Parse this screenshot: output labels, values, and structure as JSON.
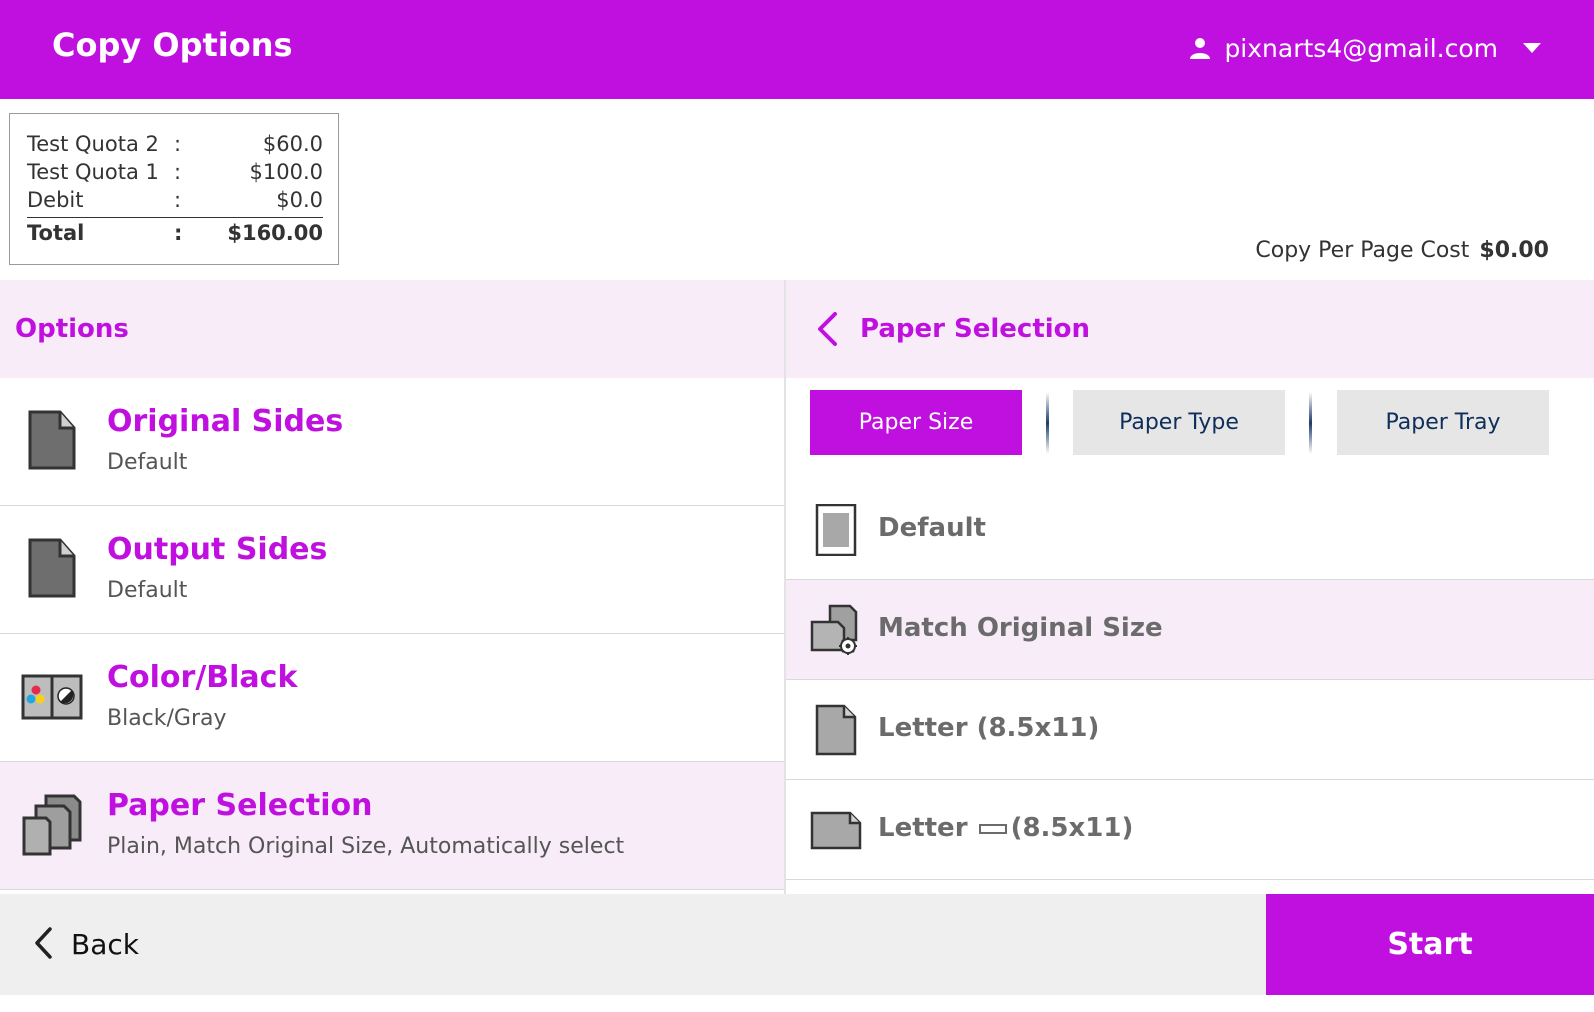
{
  "header": {
    "title": "Copy Options",
    "user_email": "pixnarts4@gmail.com"
  },
  "quota": {
    "rows": [
      {
        "label": "Test Quota 2",
        "sep": ":",
        "value": "$60.0"
      },
      {
        "label": "Test Quota 1",
        "sep": ":",
        "value": "$100.0"
      },
      {
        "label": "Debit",
        "sep": ":",
        "value": "$0.0"
      }
    ],
    "total": {
      "label": "Total",
      "sep": ":",
      "value": "$160.00"
    }
  },
  "cost": {
    "label": "Copy Per Page Cost",
    "value": "$0.00"
  },
  "options_panel": {
    "title": "Options",
    "items": [
      {
        "title": "Original Sides",
        "subtitle": "Default",
        "icon": "document-icon"
      },
      {
        "title": "Output Sides",
        "subtitle": "Default",
        "icon": "document-icon"
      },
      {
        "title": "Color/Black",
        "subtitle": "Black/Gray",
        "icon": "color-black-icon"
      },
      {
        "title": "Paper Selection",
        "subtitle": "Plain, Match Original Size, Automatically select",
        "icon": "paper-stack-icon",
        "selected": true
      }
    ]
  },
  "paper_panel": {
    "title": "Paper Selection",
    "tabs": [
      {
        "label": "Paper Size",
        "active": true
      },
      {
        "label": "Paper Type"
      },
      {
        "label": "Paper Tray"
      }
    ],
    "sizes": [
      {
        "label": "Default",
        "icon": "default-paper-icon"
      },
      {
        "label": "Match Original Size",
        "icon": "match-size-icon",
        "selected": true
      },
      {
        "label": "Letter (8.5x11)",
        "icon": "letter-portrait-icon"
      },
      {
        "label_pre": "Letter",
        "label_post": "(8.5x11)",
        "icon": "letter-landscape-icon"
      }
    ]
  },
  "bottom": {
    "back_label": "Back",
    "start_label": "Start"
  },
  "colors": {
    "accent": "#c010e0",
    "selected_bg": "#f7ecf8",
    "tab_inactive": "#e6e6e6"
  }
}
